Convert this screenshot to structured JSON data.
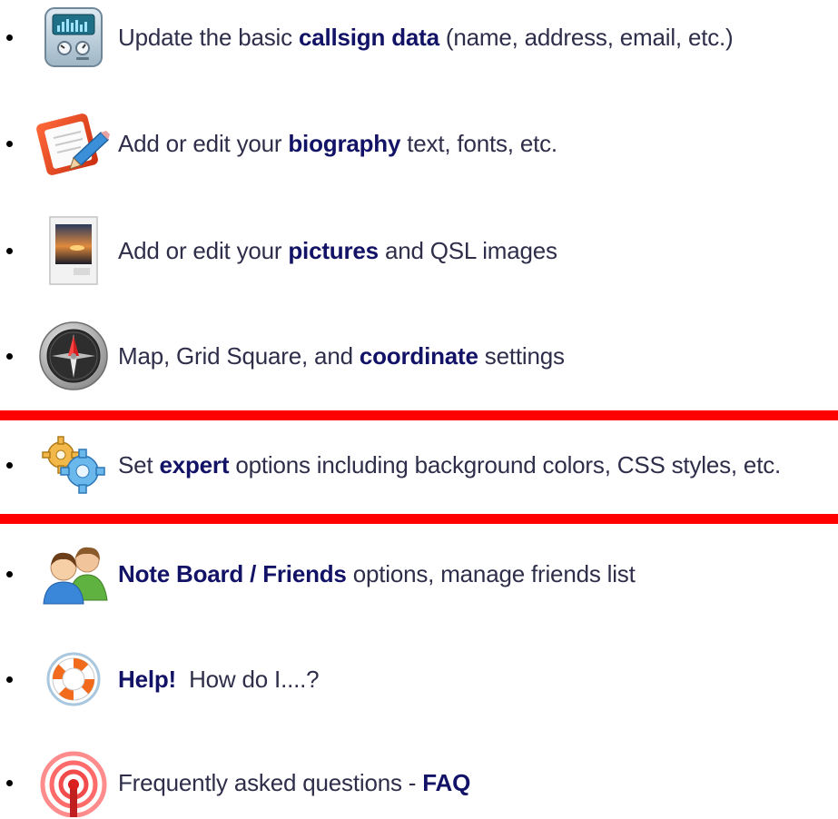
{
  "colors": {
    "highlight": "#ff0000",
    "link": "#121266",
    "text": "#2e2e4a"
  },
  "items": [
    {
      "icon": "control-panel-icon",
      "pre": "Update the basic ",
      "link": "callsign data",
      "post": " (name, address, email, etc.)"
    },
    {
      "icon": "edit-pencil-icon",
      "pre": "Add or edit your ",
      "link": "biography",
      "post": " text, fonts, etc."
    },
    {
      "icon": "jpeg-picture-icon",
      "pre": "Add or edit your ",
      "link": "pictures",
      "post": " and QSL images"
    },
    {
      "icon": "compass-icon",
      "pre": "Map, Grid Square, and ",
      "link": "coordinate",
      "post": " settings"
    },
    {
      "icon": "gears-icon",
      "pre": "Set ",
      "link": "expert",
      "post": " options including background colors, CSS styles, etc."
    },
    {
      "icon": "friends-icon",
      "pre": "",
      "link": "Note Board / Friends",
      "post": " options, manage friends list"
    },
    {
      "icon": "lifebuoy-icon",
      "pre": "",
      "link": "Help!",
      "post": "  How do I....?"
    },
    {
      "icon": "broadcast-antenna-icon",
      "pre": "Frequently asked questions - ",
      "link": "FAQ",
      "post": ""
    }
  ]
}
